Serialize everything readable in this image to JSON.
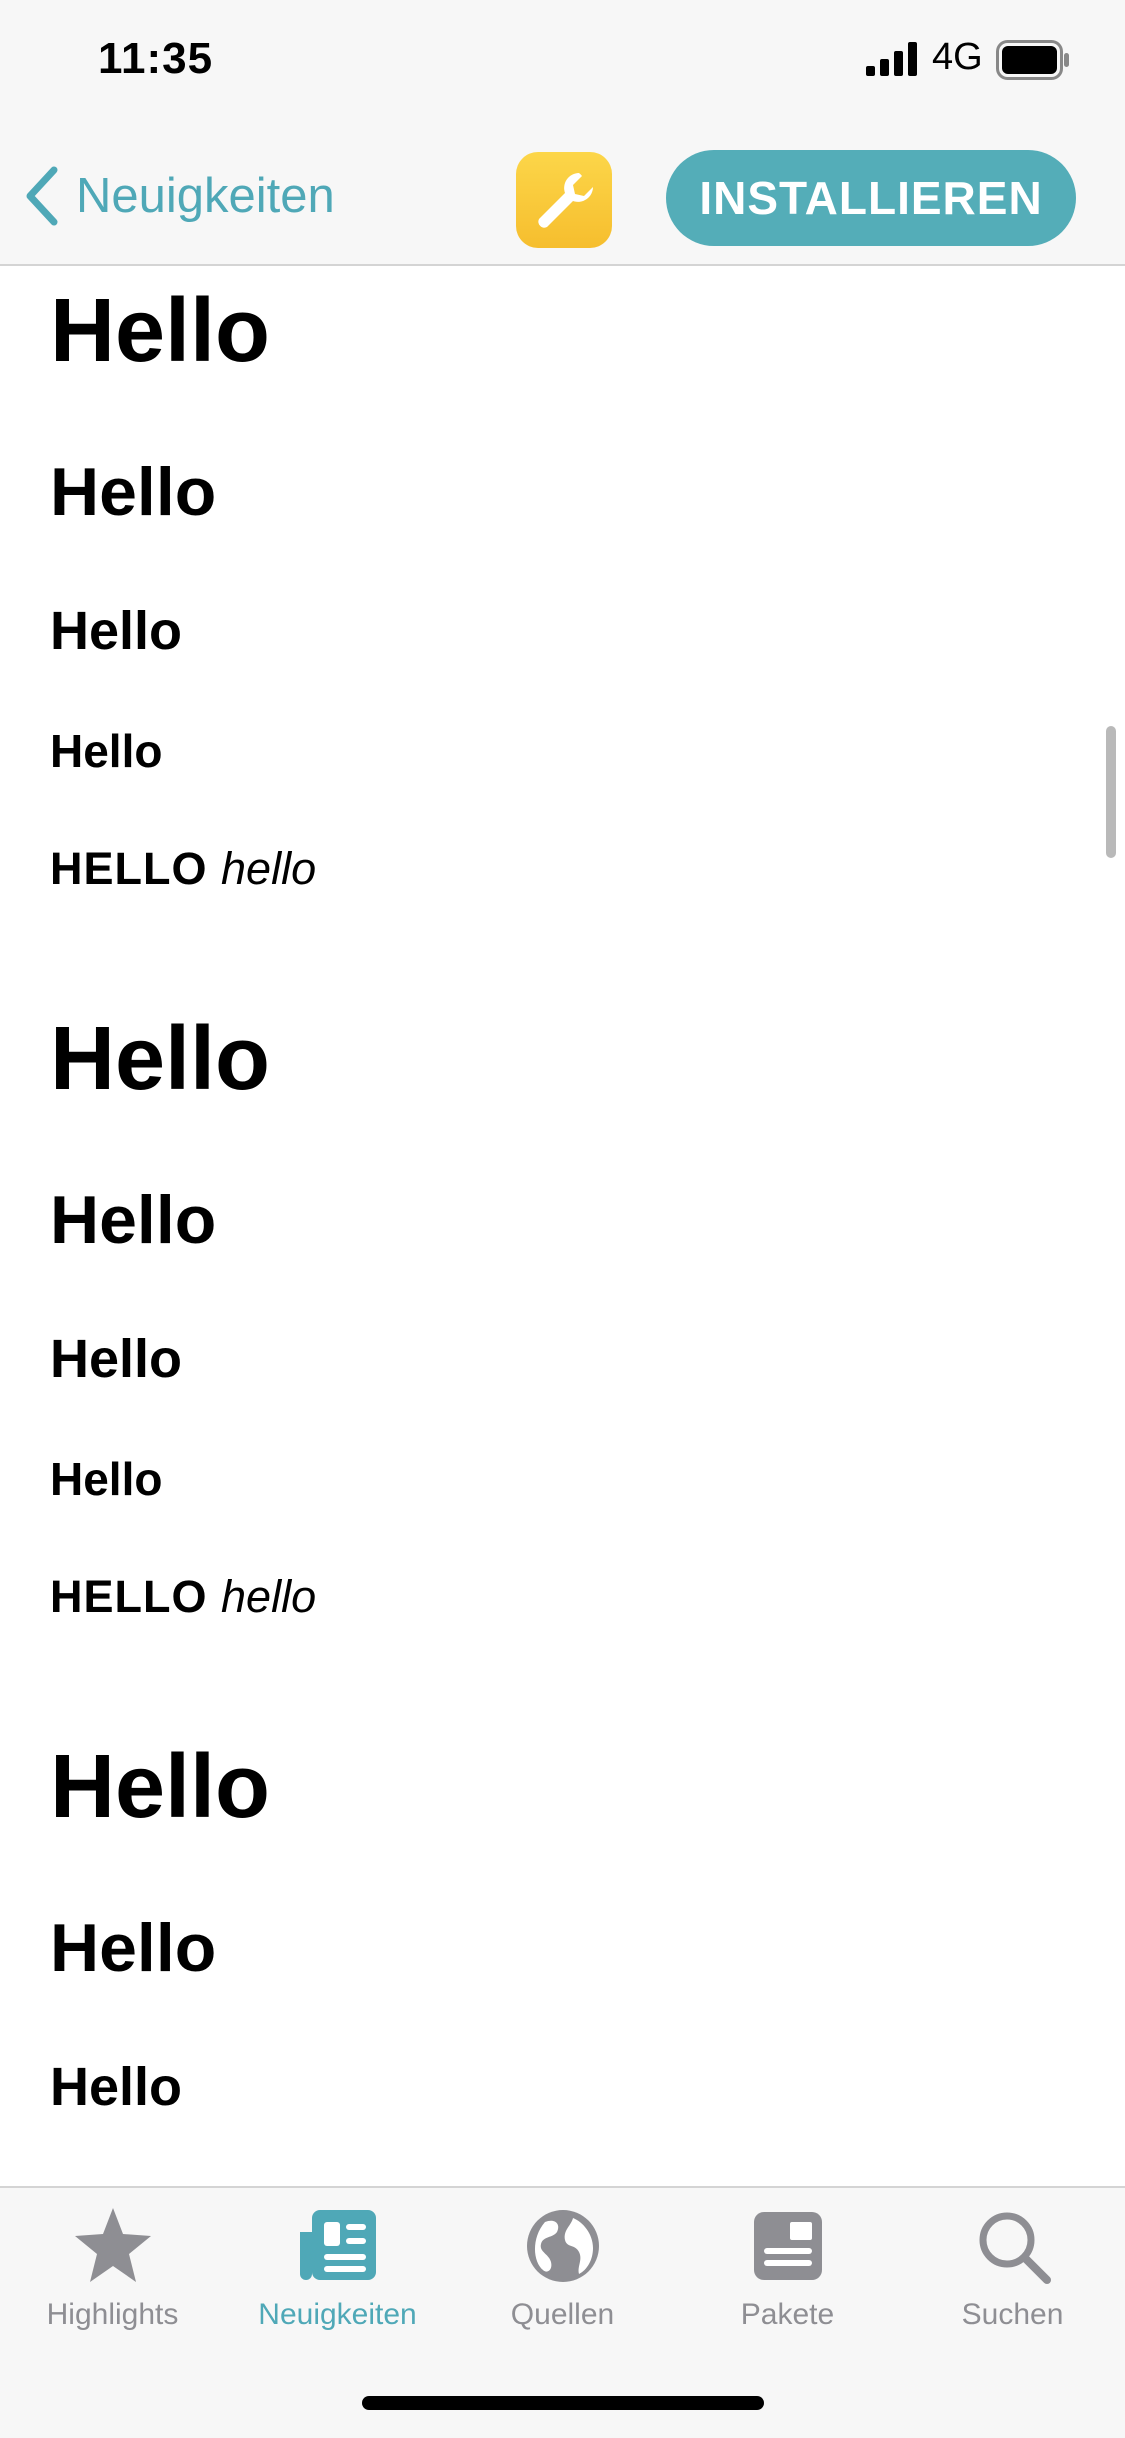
{
  "status_bar": {
    "time": "11:35",
    "network": "4G",
    "signal_icon": "cellular-signal-icon",
    "battery_icon": "battery-icon"
  },
  "nav": {
    "back_label": "Neuigkeiten",
    "back_icon": "chevron-left-icon",
    "app_icon": "wrench-icon",
    "install_label": "INSTALLIEREN",
    "accent_color": "#4fa8b7",
    "app_icon_color": "#f8c93a"
  },
  "content": {
    "groups": [
      {
        "h1": "Hello",
        "h2": "Hello",
        "h3": "Hello",
        "h4": "Hello",
        "h5_caps": "HELLO",
        "h5_italic": "hello"
      },
      {
        "h1": "Hello",
        "h2": "Hello",
        "h3": "Hello",
        "h4": "Hello",
        "h5_caps": "HELLO",
        "h5_italic": "hello"
      },
      {
        "h1": "Hello",
        "h2": "Hello",
        "h3": "Hello"
      }
    ]
  },
  "tabbar": {
    "active_index": 1,
    "items": [
      {
        "label": "Highlights",
        "icon": "star-icon"
      },
      {
        "label": "Neuigkeiten",
        "icon": "newspaper-icon"
      },
      {
        "label": "Quellen",
        "icon": "globe-icon"
      },
      {
        "label": "Pakete",
        "icon": "package-icon"
      },
      {
        "label": "Suchen",
        "icon": "search-icon"
      }
    ]
  }
}
